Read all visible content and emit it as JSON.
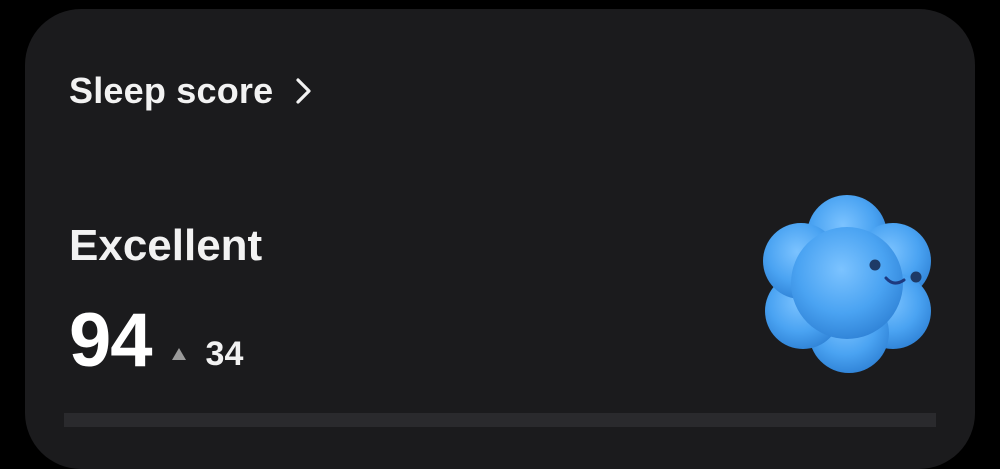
{
  "card": {
    "title": "Sleep score",
    "title_icon": "chevron-right-icon",
    "status": "Excellent",
    "score": "94",
    "delta_icon": "triangle-up-icon",
    "delta": "34",
    "mascot_icon": "smiling-cloud-mascot-icon"
  },
  "colors": {
    "background": "#000000",
    "card": "#1b1b1d",
    "text": "#f2f2f2",
    "mascot": "#4aa3f2",
    "delta_arrow": "#9a9a9a"
  }
}
